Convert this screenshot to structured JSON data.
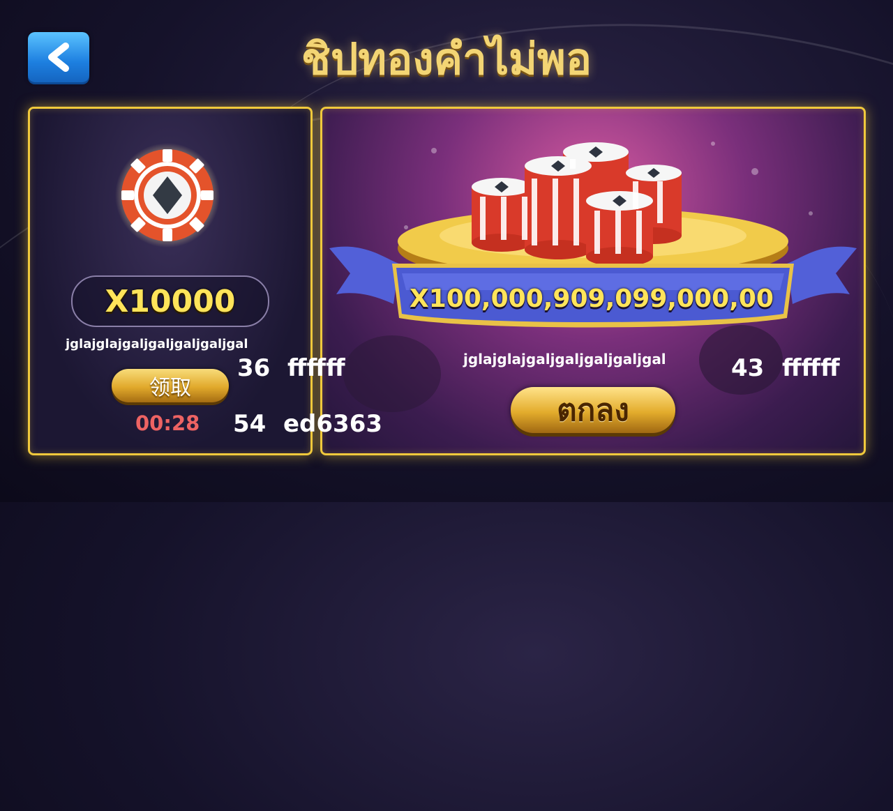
{
  "header": {
    "title": "ชิปทองคำไม่พอ"
  },
  "left_panel": {
    "multiplier": "X10000",
    "description": "jglajglajgaljgaljgaljgaljgal",
    "claim_label": "领取",
    "timer": "00:28"
  },
  "right_panel": {
    "amount": "X100,000,909,099,000,00",
    "description": "jglajglajgaljgaljgaljgaljgal",
    "confirm_label": "ตกลง"
  },
  "debug": {
    "left_size": "36",
    "left_color": "ffffff",
    "timer_size": "54",
    "timer_color": "ed6363",
    "right_size": "43",
    "right_color": "ffffff"
  },
  "colors": {
    "gold_border": "#f0c93c",
    "timer_red": "#ed6363",
    "amount_yellow": "#ffe45a",
    "back_blue": "#1d7fe0"
  }
}
